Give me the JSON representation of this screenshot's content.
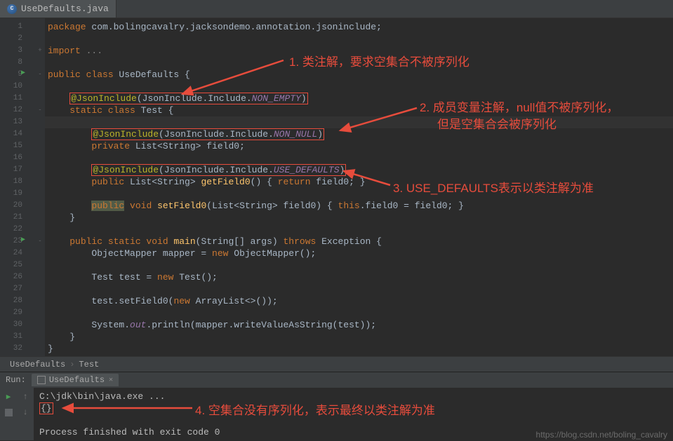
{
  "tab": {
    "filename": "UseDefaults.java"
  },
  "code": {
    "lines": [
      {
        "n": 1,
        "tokens": [
          [
            "kw",
            "package "
          ],
          [
            "str",
            "com.bolingcavalry.jacksondemo.annotation.jsoninclude;"
          ]
        ]
      },
      {
        "n": 2,
        "tokens": []
      },
      {
        "n": 3,
        "fold": "+",
        "tokens": [
          [
            "kw",
            "import "
          ],
          [
            "cmt",
            "..."
          ]
        ]
      },
      {
        "n": 8,
        "tokens": []
      },
      {
        "n": 9,
        "play": true,
        "fold": "-",
        "tokens": [
          [
            "kw",
            "public class "
          ],
          [
            "cls",
            "UseDefaults {"
          ]
        ]
      },
      {
        "n": 10,
        "tokens": []
      },
      {
        "n": 11,
        "tokens": [
          [
            "str",
            "    "
          ],
          [
            "box-start",
            ""
          ],
          [
            "ann",
            "@JsonInclude"
          ],
          [
            "str",
            "(JsonInclude.Include."
          ],
          [
            "cnst",
            "NON_EMPTY"
          ],
          [
            "str",
            ")"
          ],
          [
            "box-end",
            ""
          ]
        ]
      },
      {
        "n": 12,
        "fold": "-",
        "tokens": [
          [
            "str",
            "    "
          ],
          [
            "kw",
            "static class "
          ],
          [
            "cls",
            "Test {"
          ]
        ]
      },
      {
        "n": 13,
        "hl": true,
        "tokens": []
      },
      {
        "n": 14,
        "tokens": [
          [
            "str",
            "        "
          ],
          [
            "box-start",
            ""
          ],
          [
            "ann",
            "@JsonInclude"
          ],
          [
            "str",
            "(JsonInclude.Include."
          ],
          [
            "cnst",
            "NON_NULL"
          ],
          [
            "str",
            ")"
          ],
          [
            "box-end",
            ""
          ]
        ]
      },
      {
        "n": 15,
        "tokens": [
          [
            "str",
            "        "
          ],
          [
            "kw",
            "private "
          ],
          [
            "cls",
            "List<String> "
          ],
          [
            "str",
            "field0;"
          ]
        ]
      },
      {
        "n": 16,
        "tokens": []
      },
      {
        "n": 17,
        "tokens": [
          [
            "str",
            "        "
          ],
          [
            "box-start",
            ""
          ],
          [
            "ann",
            "@JsonInclude"
          ],
          [
            "str",
            "(JsonInclude.Include."
          ],
          [
            "cnst",
            "USE_DEFAULTS"
          ],
          [
            "str",
            ")"
          ],
          [
            "box-end",
            ""
          ]
        ]
      },
      {
        "n": 18,
        "tokens": [
          [
            "str",
            "        "
          ],
          [
            "kw",
            "public "
          ],
          [
            "cls",
            "List<String> "
          ],
          [
            "fn",
            "getField0"
          ],
          [
            "str",
            "() { "
          ],
          [
            "kw",
            "return "
          ],
          [
            "str",
            "field0; }"
          ]
        ]
      },
      {
        "n": 19,
        "tokens": []
      },
      {
        "n": 20,
        "tokens": [
          [
            "str",
            "        "
          ],
          [
            "hl-bg",
            "public"
          ],
          [
            " ",
            " "
          ],
          [
            "kw",
            "void "
          ],
          [
            "fn",
            "setField0"
          ],
          [
            "str",
            "(List<String> field0) { "
          ],
          [
            "kw",
            "this"
          ],
          [
            "str",
            ".field0 = field0; }"
          ]
        ]
      },
      {
        "n": 21,
        "tokens": [
          [
            "str",
            "    }"
          ]
        ]
      },
      {
        "n": 22,
        "tokens": []
      },
      {
        "n": 23,
        "play": true,
        "fold": "-",
        "tokens": [
          [
            "str",
            "    "
          ],
          [
            "kw",
            "public static void "
          ],
          [
            "fn",
            "main"
          ],
          [
            "str",
            "(String[] args) "
          ],
          [
            "kw",
            "throws "
          ],
          [
            "cls",
            "Exception {"
          ]
        ]
      },
      {
        "n": 24,
        "tokens": [
          [
            "str",
            "        ObjectMapper mapper = "
          ],
          [
            "kw",
            "new "
          ],
          [
            "str",
            "ObjectMapper();"
          ]
        ]
      },
      {
        "n": 25,
        "tokens": []
      },
      {
        "n": 26,
        "tokens": [
          [
            "str",
            "        Test test = "
          ],
          [
            "kw",
            "new "
          ],
          [
            "str",
            "Test();"
          ]
        ]
      },
      {
        "n": 27,
        "tokens": []
      },
      {
        "n": 28,
        "tokens": [
          [
            "str",
            "        test.setField0("
          ],
          [
            "kw",
            "new "
          ],
          [
            "str",
            "ArrayList<>());"
          ]
        ]
      },
      {
        "n": 29,
        "tokens": []
      },
      {
        "n": 30,
        "tokens": [
          [
            "str",
            "        System."
          ],
          [
            "cnst",
            "out"
          ],
          [
            "str",
            ".println(mapper.writeValueAsString(test));"
          ]
        ]
      },
      {
        "n": 31,
        "tokens": [
          [
            "str",
            "    }"
          ]
        ]
      },
      {
        "n": 32,
        "tokens": [
          [
            "str",
            "}"
          ]
        ]
      }
    ]
  },
  "notes": {
    "n1": "1. 类注解，要求空集合不被序列化",
    "n2a": "2. 成员变量注解，null值不被序列化，",
    "n2b": "但是空集合会被序列化",
    "n3": "3. USE_DEFAULTS表示以类注解为准",
    "n4": "4. 空集合没有序列化，表示最终以类注解为准"
  },
  "breadcrumb": {
    "a": "UseDefaults",
    "b": "Test"
  },
  "run": {
    "label": "Run:",
    "tabName": "UseDefaults",
    "out1": "C:\\jdk\\bin\\java.exe ...",
    "out2": "{}",
    "out3": "Process finished with exit code 0"
  },
  "watermark": "https://blog.csdn.net/boling_cavalry"
}
